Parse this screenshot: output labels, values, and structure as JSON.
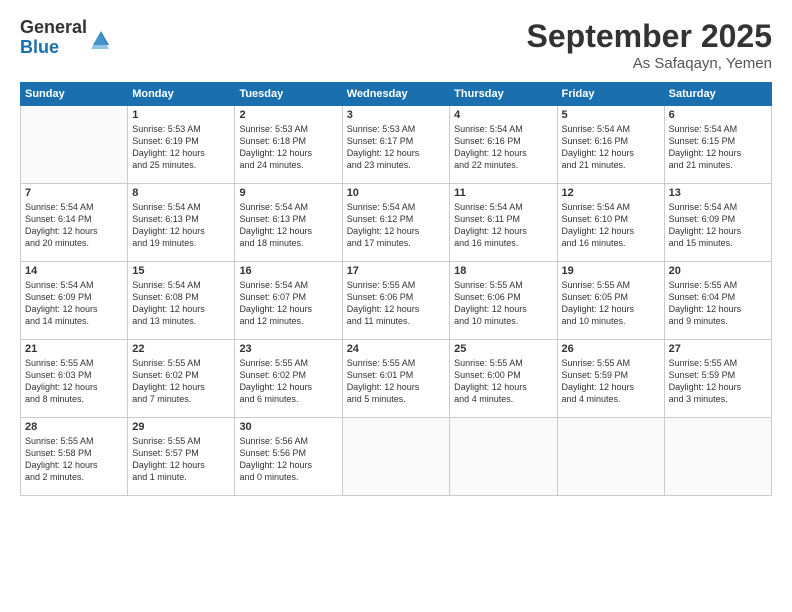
{
  "logo": {
    "general": "General",
    "blue": "Blue"
  },
  "title": {
    "month": "September 2025",
    "location": "As Safaqayn, Yemen"
  },
  "days_header": [
    "Sunday",
    "Monday",
    "Tuesday",
    "Wednesday",
    "Thursday",
    "Friday",
    "Saturday"
  ],
  "weeks": [
    [
      {
        "num": "",
        "info": ""
      },
      {
        "num": "1",
        "info": "Sunrise: 5:53 AM\nSunset: 6:19 PM\nDaylight: 12 hours\nand 25 minutes."
      },
      {
        "num": "2",
        "info": "Sunrise: 5:53 AM\nSunset: 6:18 PM\nDaylight: 12 hours\nand 24 minutes."
      },
      {
        "num": "3",
        "info": "Sunrise: 5:53 AM\nSunset: 6:17 PM\nDaylight: 12 hours\nand 23 minutes."
      },
      {
        "num": "4",
        "info": "Sunrise: 5:54 AM\nSunset: 6:16 PM\nDaylight: 12 hours\nand 22 minutes."
      },
      {
        "num": "5",
        "info": "Sunrise: 5:54 AM\nSunset: 6:16 PM\nDaylight: 12 hours\nand 21 minutes."
      },
      {
        "num": "6",
        "info": "Sunrise: 5:54 AM\nSunset: 6:15 PM\nDaylight: 12 hours\nand 21 minutes."
      }
    ],
    [
      {
        "num": "7",
        "info": "Sunrise: 5:54 AM\nSunset: 6:14 PM\nDaylight: 12 hours\nand 20 minutes."
      },
      {
        "num": "8",
        "info": "Sunrise: 5:54 AM\nSunset: 6:13 PM\nDaylight: 12 hours\nand 19 minutes."
      },
      {
        "num": "9",
        "info": "Sunrise: 5:54 AM\nSunset: 6:13 PM\nDaylight: 12 hours\nand 18 minutes."
      },
      {
        "num": "10",
        "info": "Sunrise: 5:54 AM\nSunset: 6:12 PM\nDaylight: 12 hours\nand 17 minutes."
      },
      {
        "num": "11",
        "info": "Sunrise: 5:54 AM\nSunset: 6:11 PM\nDaylight: 12 hours\nand 16 minutes."
      },
      {
        "num": "12",
        "info": "Sunrise: 5:54 AM\nSunset: 6:10 PM\nDaylight: 12 hours\nand 16 minutes."
      },
      {
        "num": "13",
        "info": "Sunrise: 5:54 AM\nSunset: 6:09 PM\nDaylight: 12 hours\nand 15 minutes."
      }
    ],
    [
      {
        "num": "14",
        "info": "Sunrise: 5:54 AM\nSunset: 6:09 PM\nDaylight: 12 hours\nand 14 minutes."
      },
      {
        "num": "15",
        "info": "Sunrise: 5:54 AM\nSunset: 6:08 PM\nDaylight: 12 hours\nand 13 minutes."
      },
      {
        "num": "16",
        "info": "Sunrise: 5:54 AM\nSunset: 6:07 PM\nDaylight: 12 hours\nand 12 minutes."
      },
      {
        "num": "17",
        "info": "Sunrise: 5:55 AM\nSunset: 6:06 PM\nDaylight: 12 hours\nand 11 minutes."
      },
      {
        "num": "18",
        "info": "Sunrise: 5:55 AM\nSunset: 6:06 PM\nDaylight: 12 hours\nand 10 minutes."
      },
      {
        "num": "19",
        "info": "Sunrise: 5:55 AM\nSunset: 6:05 PM\nDaylight: 12 hours\nand 10 minutes."
      },
      {
        "num": "20",
        "info": "Sunrise: 5:55 AM\nSunset: 6:04 PM\nDaylight: 12 hours\nand 9 minutes."
      }
    ],
    [
      {
        "num": "21",
        "info": "Sunrise: 5:55 AM\nSunset: 6:03 PM\nDaylight: 12 hours\nand 8 minutes."
      },
      {
        "num": "22",
        "info": "Sunrise: 5:55 AM\nSunset: 6:02 PM\nDaylight: 12 hours\nand 7 minutes."
      },
      {
        "num": "23",
        "info": "Sunrise: 5:55 AM\nSunset: 6:02 PM\nDaylight: 12 hours\nand 6 minutes."
      },
      {
        "num": "24",
        "info": "Sunrise: 5:55 AM\nSunset: 6:01 PM\nDaylight: 12 hours\nand 5 minutes."
      },
      {
        "num": "25",
        "info": "Sunrise: 5:55 AM\nSunset: 6:00 PM\nDaylight: 12 hours\nand 4 minutes."
      },
      {
        "num": "26",
        "info": "Sunrise: 5:55 AM\nSunset: 5:59 PM\nDaylight: 12 hours\nand 4 minutes."
      },
      {
        "num": "27",
        "info": "Sunrise: 5:55 AM\nSunset: 5:59 PM\nDaylight: 12 hours\nand 3 minutes."
      }
    ],
    [
      {
        "num": "28",
        "info": "Sunrise: 5:55 AM\nSunset: 5:58 PM\nDaylight: 12 hours\nand 2 minutes."
      },
      {
        "num": "29",
        "info": "Sunrise: 5:55 AM\nSunset: 5:57 PM\nDaylight: 12 hours\nand 1 minute."
      },
      {
        "num": "30",
        "info": "Sunrise: 5:56 AM\nSunset: 5:56 PM\nDaylight: 12 hours\nand 0 minutes."
      },
      {
        "num": "",
        "info": ""
      },
      {
        "num": "",
        "info": ""
      },
      {
        "num": "",
        "info": ""
      },
      {
        "num": "",
        "info": ""
      }
    ]
  ]
}
